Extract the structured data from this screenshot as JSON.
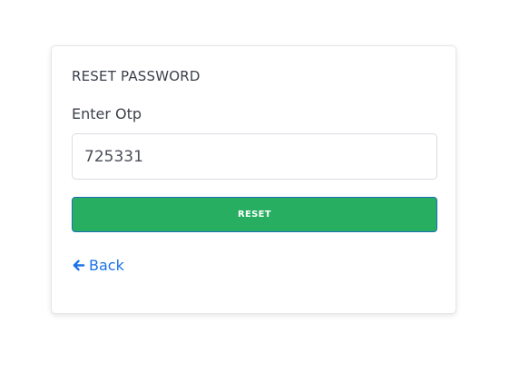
{
  "form": {
    "title": "RESET PASSWORD",
    "otp_label": "Enter Otp",
    "otp_value": "725331",
    "reset_label": "RESET",
    "back_label": "Back",
    "back_icon": "arrow-left-icon"
  },
  "colors": {
    "button_bg": "#27ae60",
    "button_border": "#1d6fb8",
    "link": "#1b73e8"
  }
}
